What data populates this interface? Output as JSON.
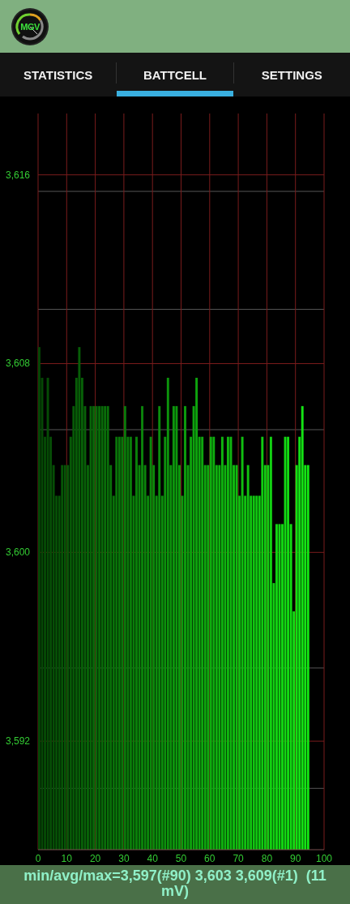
{
  "header": {
    "logo_text": "MGV"
  },
  "tabs": [
    {
      "label": "STATISTICS",
      "selected": false
    },
    {
      "label": "BATTCELL",
      "selected": true
    },
    {
      "label": "SETTINGS",
      "selected": false
    }
  ],
  "chart_data": {
    "type": "bar",
    "grid": true,
    "xlim": [
      0,
      100
    ],
    "ylim": [
      3587.4,
      3618.6
    ],
    "xticks": [
      0,
      10,
      20,
      30,
      40,
      50,
      60,
      70,
      80,
      90,
      100
    ],
    "yticks": [
      {
        "value": 3592,
        "label": "3,592"
      },
      {
        "value": 3600,
        "label": "3,600"
      },
      {
        "value": 3608,
        "label": "3,608"
      },
      {
        "value": 3616,
        "label": "3,616"
      }
    ],
    "x": [
      0.5,
      1.5,
      2.5,
      3.5,
      4.5,
      5.5,
      6.5,
      7.5,
      8.5,
      9.5,
      10.5,
      11.5,
      12.5,
      13.5,
      14.5,
      15.5,
      16.5,
      17.5,
      18.5,
      19.5,
      20.5,
      21.5,
      22.5,
      23.5,
      24.5,
      25.5,
      26.5,
      27.5,
      28.5,
      29.5,
      30.5,
      31.5,
      32.5,
      33.5,
      34.5,
      35.5,
      36.5,
      37.5,
      38.5,
      39.5,
      40.5,
      41.5,
      42.5,
      43.5,
      44.5,
      45.5,
      46.5,
      47.5,
      48.5,
      49.5,
      50.5,
      51.5,
      52.5,
      53.5,
      54.5,
      55.5,
      56.5,
      57.5,
      58.5,
      59.5,
      60.5,
      61.5,
      62.5,
      63.5,
      64.5,
      65.5,
      66.5,
      67.5,
      68.5,
      69.5,
      70.5,
      71.5,
      72.5,
      73.5,
      74.5,
      75.5,
      76.5,
      77.5,
      78.5,
      79.5,
      80.5,
      81.5,
      82.5,
      83.5,
      84.5,
      85.5,
      86.5,
      87.5,
      88.5,
      89.5,
      90.5,
      91.5,
      92.5,
      93.5,
      94.5
    ],
    "values": [
      3608.7,
      3607.4,
      3604.9,
      3607.4,
      3604.9,
      3603.7,
      3602.4,
      3602.4,
      3603.7,
      3603.7,
      3603.7,
      3604.9,
      3606.2,
      3607.4,
      3608.7,
      3607.4,
      3606.2,
      3603.7,
      3606.2,
      3606.2,
      3606.2,
      3606.2,
      3606.2,
      3606.2,
      3606.2,
      3603.7,
      3602.4,
      3604.9,
      3604.9,
      3604.9,
      3606.2,
      3604.9,
      3604.9,
      3602.4,
      3604.9,
      3603.7,
      3606.2,
      3603.7,
      3602.4,
      3604.9,
      3603.7,
      3602.4,
      3606.2,
      3602.4,
      3604.9,
      3607.4,
      3603.7,
      3606.2,
      3606.2,
      3603.7,
      3602.4,
      3606.2,
      3603.7,
      3604.9,
      3606.2,
      3607.4,
      3604.9,
      3604.9,
      3603.7,
      3603.7,
      3604.9,
      3604.9,
      3603.7,
      3603.7,
      3604.9,
      3603.7,
      3604.9,
      3604.9,
      3603.7,
      3603.7,
      3602.4,
      3604.9,
      3602.4,
      3603.7,
      3602.4,
      3602.4,
      3602.4,
      3602.4,
      3604.9,
      3603.7,
      3603.7,
      3604.9,
      3598.7,
      3601.2,
      3601.2,
      3601.2,
      3604.9,
      3604.9,
      3601.2,
      3597.5,
      3603.7,
      3604.9,
      3606.2,
      3603.7,
      3603.7
    ]
  },
  "summary": "min/avg/max=3,597(#90) 3,603 3,609(#1)  (11 mV)"
}
